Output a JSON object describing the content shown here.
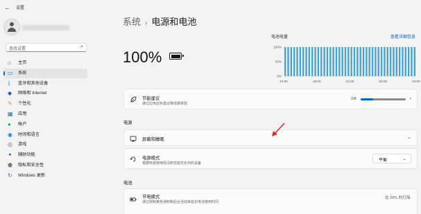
{
  "window": {
    "title": "设置",
    "back_glyph": "←"
  },
  "search": {
    "placeholder": "查找设置",
    "icon": "search-icon"
  },
  "nav": [
    {
      "label": "主页",
      "icon": "home-icon",
      "color": "#5b5b5b",
      "active": false
    },
    {
      "label": "系统",
      "icon": "system-icon",
      "color": "#0078d4",
      "active": true
    },
    {
      "label": "蓝牙和其他设备",
      "icon": "bluetooth-icon",
      "color": "#0078d4",
      "active": false
    },
    {
      "label": "网络和 Internet",
      "icon": "wifi-icon",
      "color": "#1a5fb4",
      "active": false
    },
    {
      "label": "个性化",
      "icon": "brush-icon",
      "color": "#e0853a",
      "active": false
    },
    {
      "label": "应用",
      "icon": "apps-icon",
      "color": "#2a6db0",
      "active": false
    },
    {
      "label": "帐户",
      "icon": "account-icon",
      "color": "#22a36f",
      "active": false
    },
    {
      "label": "时间和语言",
      "icon": "globe-clock-icon",
      "color": "#1f7ac6",
      "active": false
    },
    {
      "label": "游戏",
      "icon": "gamepad-icon",
      "color": "#6b6b6b",
      "active": false
    },
    {
      "label": "辅助功能",
      "icon": "accessibility-icon",
      "color": "#2b6dc9",
      "active": false
    },
    {
      "label": "隐私和安全性",
      "icon": "shield-icon",
      "color": "#777777",
      "active": false
    },
    {
      "label": "Windows 更新",
      "icon": "update-icon",
      "color": "#1f7ac6",
      "active": false
    }
  ],
  "breadcrumb": {
    "parent": "系统",
    "separator": "›",
    "current": "电源和电池"
  },
  "battery": {
    "percent": "100%",
    "icon": "battery-full-icon"
  },
  "chart_header": {
    "title": "电池电量",
    "link": "查看详细信息"
  },
  "chart_data": {
    "type": "bar",
    "title": "电池电量",
    "y_ticks": [
      "100%",
      "50%",
      "0%"
    ],
    "ylim": [
      0,
      100
    ],
    "x_ticks": [
      "10:00",
      "16:00",
      "22:00",
      "04:00",
      "10:00"
    ],
    "values": [
      100,
      100,
      100,
      100,
      100,
      100,
      100,
      100,
      100,
      100,
      100,
      100,
      100,
      100,
      100,
      100,
      100,
      100,
      100,
      100,
      100,
      100,
      100,
      100,
      100,
      100,
      100,
      100,
      100,
      100,
      100,
      100,
      100,
      100,
      100,
      100,
      100,
      100,
      100,
      100,
      100,
      100,
      100,
      100
    ],
    "bar_color": "#4aa3c9",
    "grid": true
  },
  "energy_card": {
    "title": "节能建议",
    "desc": "通过应用这些建议降低碳排放",
    "count": "2/8",
    "progress": 0.28,
    "icon": "leaf-icon"
  },
  "power_section": {
    "label": "电源"
  },
  "screen_sleep": {
    "title": "屏幕和睡眠",
    "icon": "monitor-sleep-icon"
  },
  "power_mode": {
    "title": "电源模式",
    "desc": "根据电源使用情况和性能优化你的设备",
    "value": "平衡",
    "icon": "power-mode-icon"
  },
  "battery_section": {
    "label": "电池"
  },
  "battery_saver": {
    "title": "节电模式",
    "desc": "通过限制某些通知和后台活动来延长电池使用时间",
    "status": "在 20% 时打开",
    "icon": "battery-saver-icon"
  },
  "annotation": {
    "arrow_color": "#d9302c"
  }
}
